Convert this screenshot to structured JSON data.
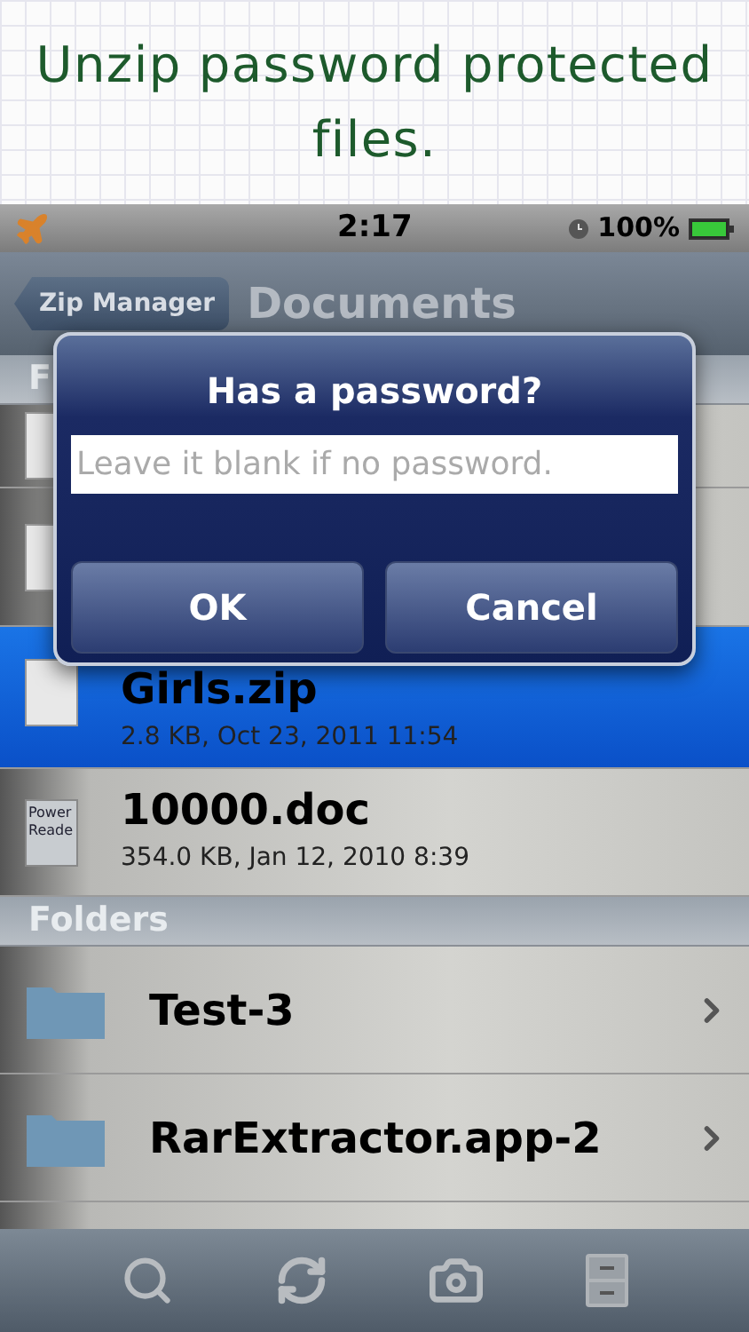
{
  "caption": [
    "Unzip password protected",
    "files."
  ],
  "status_bar": {
    "time": "2:17",
    "battery": "100%"
  },
  "nav": {
    "back": "Zip Manager",
    "title": "Documents"
  },
  "sections": [
    {
      "title": "F",
      "items": [
        {
          "kind": "file",
          "selected": false
        },
        {
          "kind": "file",
          "selected": false
        },
        {
          "kind": "file",
          "name": "Girls.zip",
          "meta": "2.8 KB, Oct 23, 2011 11:54",
          "selected": true
        },
        {
          "kind": "doc",
          "name": "10000.doc",
          "meta": "354.0 KB, Jan 12, 2010 8:39",
          "thumb": [
            "Power",
            "Reade"
          ],
          "selected": false
        }
      ]
    },
    {
      "title": "Folders",
      "items": [
        {
          "kind": "folder",
          "name": "Test-3",
          "selected": false
        },
        {
          "kind": "folder",
          "name": "RarExtractor.app-2",
          "selected": false
        }
      ]
    }
  ],
  "alert": {
    "title": "Has a password?",
    "placeholder": "Leave it blank if no password.",
    "buttons": [
      "OK",
      "Cancel"
    ]
  }
}
